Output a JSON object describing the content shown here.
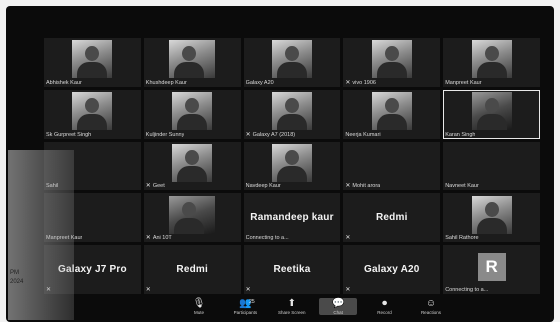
{
  "tiles": [
    {
      "name": "Abhishek Kaur",
      "type": "video"
    },
    {
      "name": "Khushdeep Kaur",
      "type": "video"
    },
    {
      "name": "Galaxy A20",
      "type": "video"
    },
    {
      "name": "vivo 1906",
      "type": "video"
    },
    {
      "name": "Manpreet Kaur",
      "type": "video"
    },
    {
      "name": "Sk Gurpreet Singh",
      "type": "video"
    },
    {
      "name": "Kuljinder Sunny",
      "type": "video"
    },
    {
      "name": "Galaxy A7 (2018)",
      "type": "video"
    },
    {
      "name": "Neerja Kumari",
      "type": "video"
    },
    {
      "name": "Karan Singh",
      "type": "video"
    },
    {
      "name": "Sahil",
      "type": "empty"
    },
    {
      "name": "Geet",
      "type": "video"
    },
    {
      "name": "Navdeep Kaur",
      "type": "video"
    },
    {
      "name": "Mohit arora",
      "type": "empty"
    },
    {
      "name": "Navneet Kaur",
      "type": "empty"
    },
    {
      "name": "Manpreet Kaur",
      "type": "empty"
    },
    {
      "name": "Ani 10T",
      "type": "video"
    },
    {
      "name": "Ramandeep kaur",
      "type": "text",
      "sub": "Connecting to a..."
    },
    {
      "name": "Redmi",
      "type": "text"
    },
    {
      "name": "Sahil Rathore",
      "type": "video"
    },
    {
      "name": "Galaxy J7 Pro",
      "type": "text"
    },
    {
      "name": "Redmi",
      "type": "text"
    },
    {
      "name": "Reetika",
      "type": "text"
    },
    {
      "name": "Galaxy A20",
      "type": "text"
    },
    {
      "name": "R",
      "type": "avatar",
      "sub": "Connecting to a..."
    }
  ],
  "toolbar": {
    "mute": "Mute",
    "participants": "Participants",
    "participants_count": "25",
    "share_screen": "Share Screen",
    "chat": "Chat",
    "record": "Record",
    "reactions": "Reactions"
  },
  "side": {
    "line1": "PM",
    "line2": "2024"
  }
}
